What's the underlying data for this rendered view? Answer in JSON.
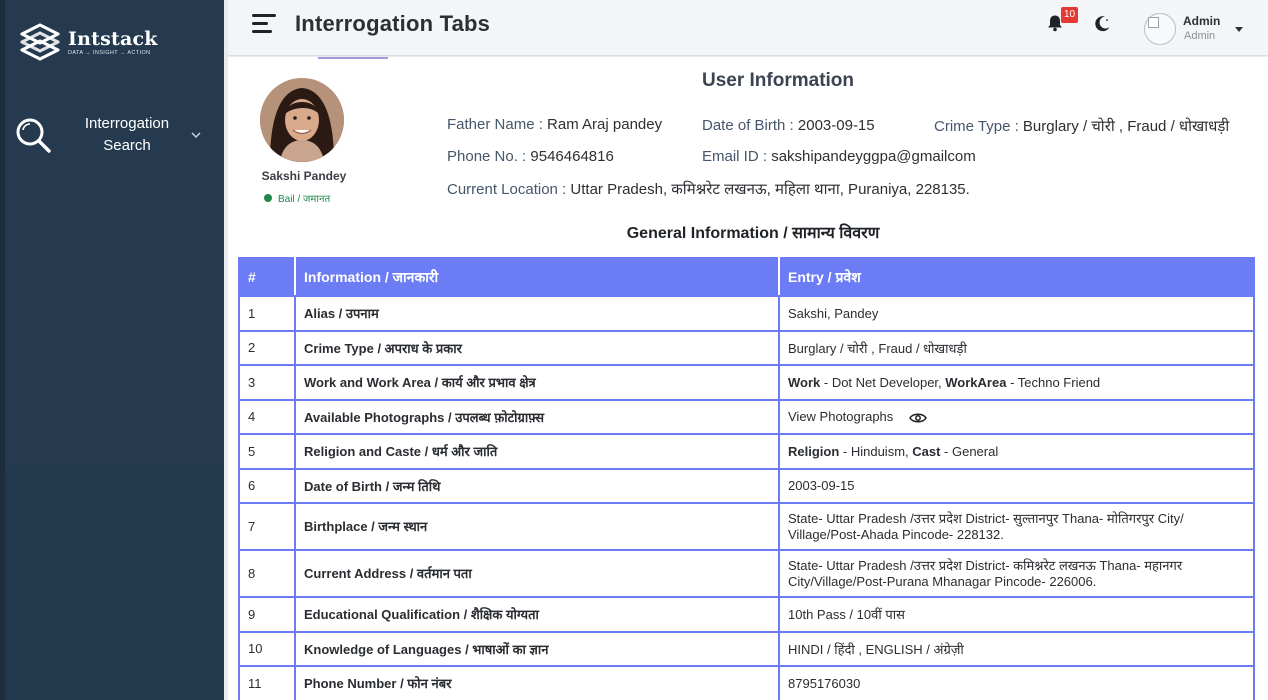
{
  "brand": {
    "name": "Intstack",
    "tagline": "DATA → INSIGHT → ACTION"
  },
  "sidebar": {
    "items": [
      {
        "label_line1": "Interrogation",
        "label_line2": "Search",
        "icon": "search-icon"
      }
    ]
  },
  "header": {
    "title": "Interrogation Tabs",
    "notifications_count": "10",
    "user_name": "Admin",
    "user_role": "Admin"
  },
  "profile": {
    "name": "Sakshi Pandey",
    "status": "Bail / जमानत"
  },
  "user_info": {
    "title": "User Information",
    "father_label": "Father Name :",
    "father_value": "Ram Araj pandey",
    "dob_label": "Date of Birth :",
    "dob_value": "2003-09-15",
    "crime_label": "Crime Type :",
    "crime_value": "Burglary / चोरी , Fraud / धोखाधड़ी",
    "phone_label": "Phone No. :",
    "phone_value": "9546464816",
    "email_label": "Email ID :",
    "email_value": "sakshipandeyggpa@gmailcom",
    "location_label": "Current Location :",
    "location_value": "Uttar Pradesh, कमिश्नरेट लखनऊ, महिला थाना, Puraniya, 228135."
  },
  "general": {
    "title": "General Information / सामान्य विवरण",
    "columns": [
      "#",
      "Information / जानकारी",
      "Entry / प्रवेश"
    ],
    "rows": [
      {
        "num": "1",
        "info": "Alias / उपनाम",
        "entry": "Sakshi, Pandey"
      },
      {
        "num": "2",
        "info": "Crime Type / अपराध के प्रकार",
        "entry": "Burglary / चोरी , Fraud / धोखाधड़ी"
      },
      {
        "num": "3",
        "info": "Work and Work Area / कार्य और प्रभाव क्षेत्र",
        "entry_k1": "Work",
        "entry_v1": " - Dot Net Developer, ",
        "entry_k2": "WorkArea",
        "entry_v2": " - Techno Friend"
      },
      {
        "num": "4",
        "info": "Available Photographs / उपलब्ध फ़ोटोग्राफ़्स",
        "entry": "View Photographs"
      },
      {
        "num": "5",
        "info": "Religion and Caste / धर्म और जाति",
        "entry_k1": "Religion",
        "entry_v1": " - Hinduism, ",
        "entry_k2": "Cast",
        "entry_v2": " - General"
      },
      {
        "num": "6",
        "info": "Date of Birth / जन्म तिथि",
        "entry": "2003-09-15"
      },
      {
        "num": "7",
        "info": "Birthplace / जन्म स्थान",
        "entry_line1": "State- Uttar Pradesh /उत्तर प्रदेश   District- सुल्तानपुर   Thana- मोतिगरपुर   City/",
        "entry_line2": "Village/Post-Ahada   Pincode- 228132."
      },
      {
        "num": "8",
        "info": "Current Address / वर्तमान पता",
        "entry_line1": "State- Uttar Pradesh /उत्तर प्रदेश   District- कमिश्नरेट लखनऊ   Thana- महानगर",
        "entry_line2": "City/Village/Post-Purana Mhanagar  Pincode- 226006."
      },
      {
        "num": "9",
        "info": "Educational Qualification / शैक्षिक योग्यता",
        "entry": "10th Pass / 10वीं पास"
      },
      {
        "num": "10",
        "info": "Knowledge of Languages / भाषाओं का ज्ञान",
        "entry": "HINDI / हिंदी , ENGLISH / अंग्रेज़ी"
      },
      {
        "num": "11",
        "info": "Phone Number / फोन नंबर",
        "entry": "8795176030"
      }
    ]
  },
  "colors": {
    "sidebar": "#253a4f",
    "table_header": "#6c7cf5",
    "status_green": "#1e8a4a",
    "badge_red": "#e53935"
  }
}
